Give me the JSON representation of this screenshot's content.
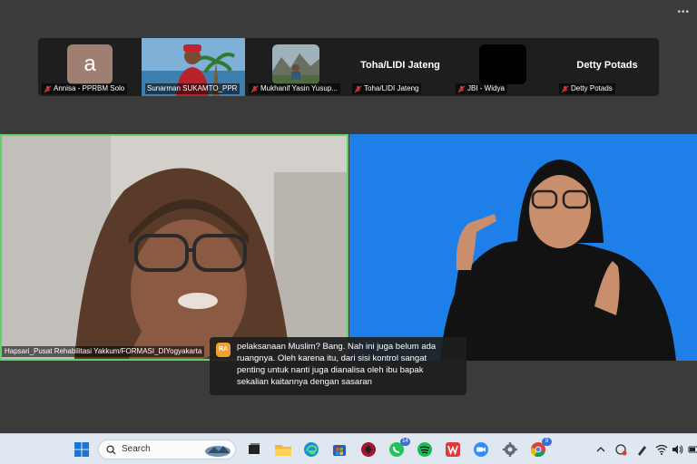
{
  "window": {
    "more_dots": "•••"
  },
  "participants": [
    {
      "name": "Annisa -  PPRBM Solo",
      "avatar_letter": "a",
      "type": "avatar"
    },
    {
      "name": "Sunarman SUKAMTO_PPR",
      "type": "video"
    },
    {
      "name": "Mukhanif Yasin Yusup...",
      "type": "photo"
    },
    {
      "name": "Toha/LIDI Jateng",
      "display_name": "Toha/LIDI Jateng",
      "type": "name"
    },
    {
      "name": "JBI - Widya",
      "type": "black"
    },
    {
      "name": "Detty Potads",
      "display_name": "Detty Potads",
      "type": "name"
    }
  ],
  "main_speaker": {
    "name": "Hapsari_Pusat Rehabilitasi Yakkum/FORMASI_DIYogyakarta"
  },
  "caption": {
    "initials": "RA",
    "lines": [
      "pelaksanaan Muslim? Bang. Nah ini juga belum ada",
      "ruangnya. Oleh karena itu, dari sisi kontrol sangat",
      "penting untuk nanti juga dianalisa oleh ibu bapak",
      "sekalian kaitannya dengan sasaran"
    ]
  },
  "taskbar": {
    "search_label": "Search",
    "whatsapp_badge": "14",
    "chrome_badge": "8"
  },
  "colors": {
    "active_speaker_border": "#5fd26b",
    "interpreter_background": "#1f7fe8",
    "caption_badge": "#f2a12b"
  }
}
